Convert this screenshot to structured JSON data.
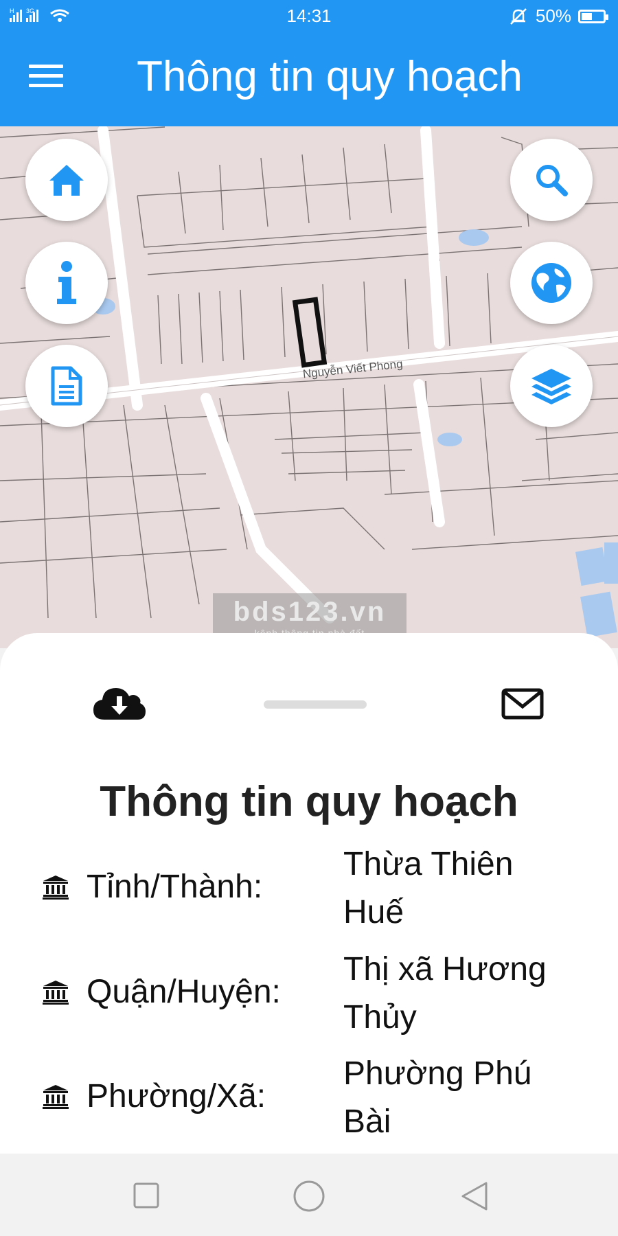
{
  "status_bar": {
    "signal_text": "H 3G",
    "time": "14:31",
    "battery": "50%",
    "battery_level": 0.5
  },
  "app_bar": {
    "title": "Thông tin quy hoạch",
    "menu_icon": "hamburger-menu-icon"
  },
  "map": {
    "street_label": "Nguyễn Viết Phong",
    "left_buttons": [
      "home-icon",
      "info-icon",
      "document-icon"
    ],
    "right_buttons": [
      "search-icon",
      "globe-icon",
      "layers-icon"
    ],
    "accent_color": "#2196f3"
  },
  "watermark": {
    "brand": "bds123.vn",
    "tagline": "kênh thông tin nhà đất"
  },
  "sheet": {
    "title": "Thông tin quy hoạch",
    "rows": [
      {
        "label": "Tỉnh/Thành:",
        "value_line1": "Thừa Thiên",
        "value_line2": "Huế"
      },
      {
        "label": "Quận/Huyện:",
        "value_line1": "Thị xã Hương",
        "value_line2": "Thủy"
      },
      {
        "label": "Phường/Xã:",
        "value_line1": "Phường Phú",
        "value_line2": "Bài"
      }
    ]
  }
}
